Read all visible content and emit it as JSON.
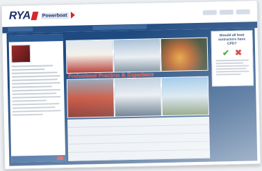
{
  "brand": {
    "logo_text": "RYA",
    "logo_subtext": "Powerboat",
    "primary_color": "#1e4a7f",
    "accent_color": "#d6262e"
  },
  "banner": {
    "text": "Professional Practices & Experience"
  },
  "promo": {
    "title": "Should all boat instructors have CPD?"
  },
  "icons": {
    "tick": "✔",
    "cross": "✖"
  }
}
